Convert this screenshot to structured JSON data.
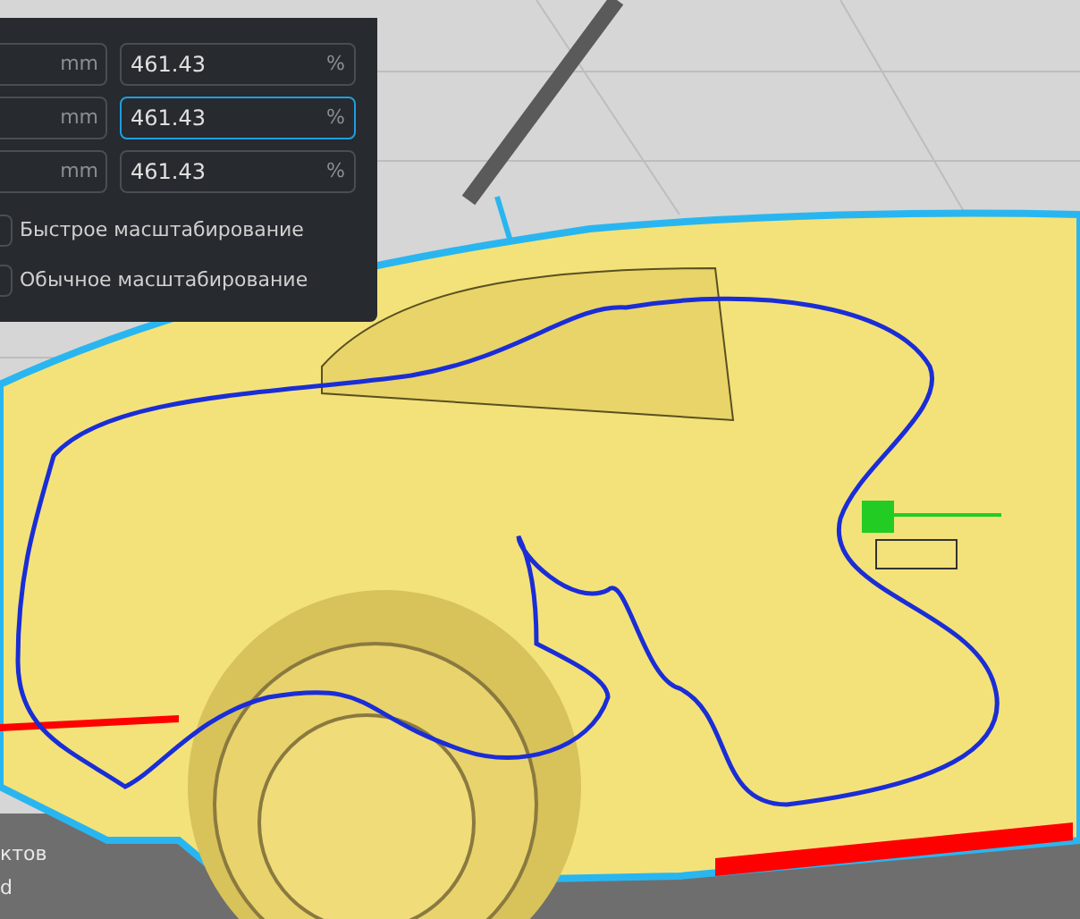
{
  "scale_rows": [
    {
      "unit": "mm",
      "percent": "461.43",
      "percent_unit": "%",
      "focused": false
    },
    {
      "unit": "mm",
      "percent": "461.43",
      "percent_unit": "%",
      "focused": true
    },
    {
      "unit": "mm",
      "percent": "461.43",
      "percent_unit": "%",
      "focused": false
    }
  ],
  "options": [
    {
      "label": "Быстрое масштабирование",
      "checked": false
    },
    {
      "label": "Обычное масштабирование",
      "checked": false
    }
  ],
  "bottom_texts": [
    "ктов",
    "d"
  ]
}
